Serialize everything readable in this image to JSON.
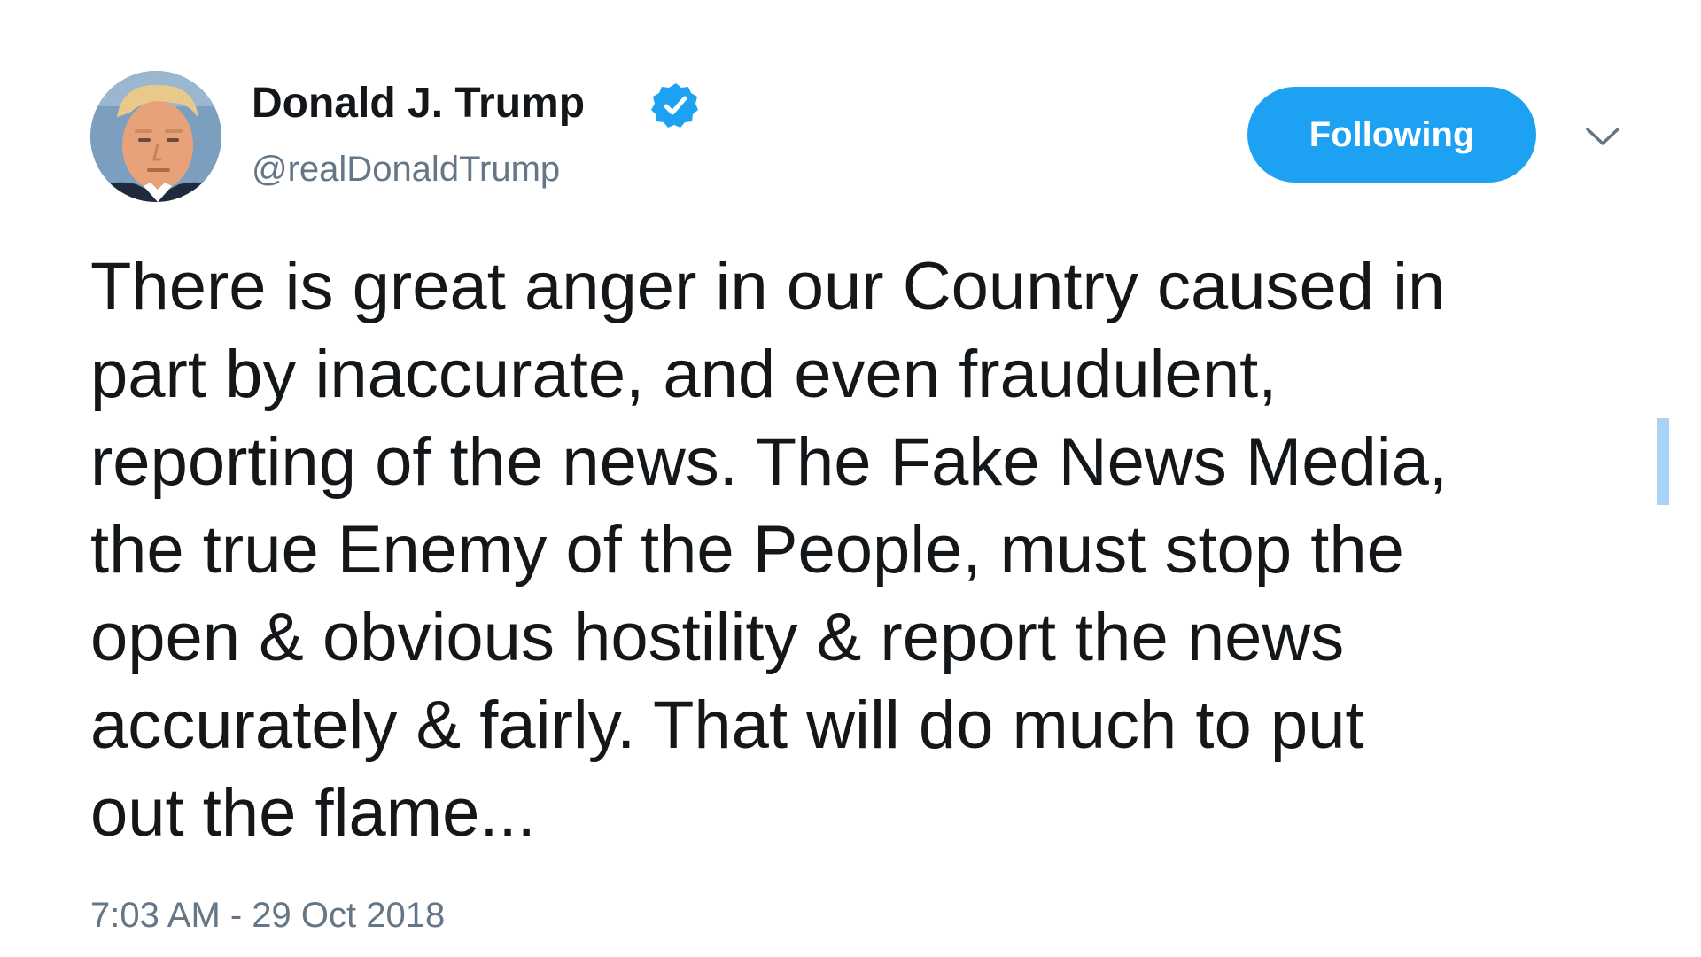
{
  "tweet": {
    "display_name": "Donald J. Trump",
    "handle": "@realDonaldTrump",
    "verified": true,
    "follow_button_label": "Following",
    "text_lines": [
      "There is great anger in our Country caused in",
      "part by inaccurate, and even fraudulent,",
      "reporting of the news. The Fake News Media,",
      "the true Enemy of the People, must stop the",
      "open & obvious hostility & report the news",
      "accurately & fairly. That will do much to put",
      "out the flame..."
    ],
    "timestamp": "7:03 AM - 29 Oct 2018"
  },
  "colors": {
    "accent": "#1da1f2",
    "text_primary": "#14171a",
    "text_secondary": "#657786",
    "selection": "#a9d3f7"
  },
  "icons": {
    "verified": "verified-badge-icon",
    "caret": "chevron-down-icon"
  }
}
